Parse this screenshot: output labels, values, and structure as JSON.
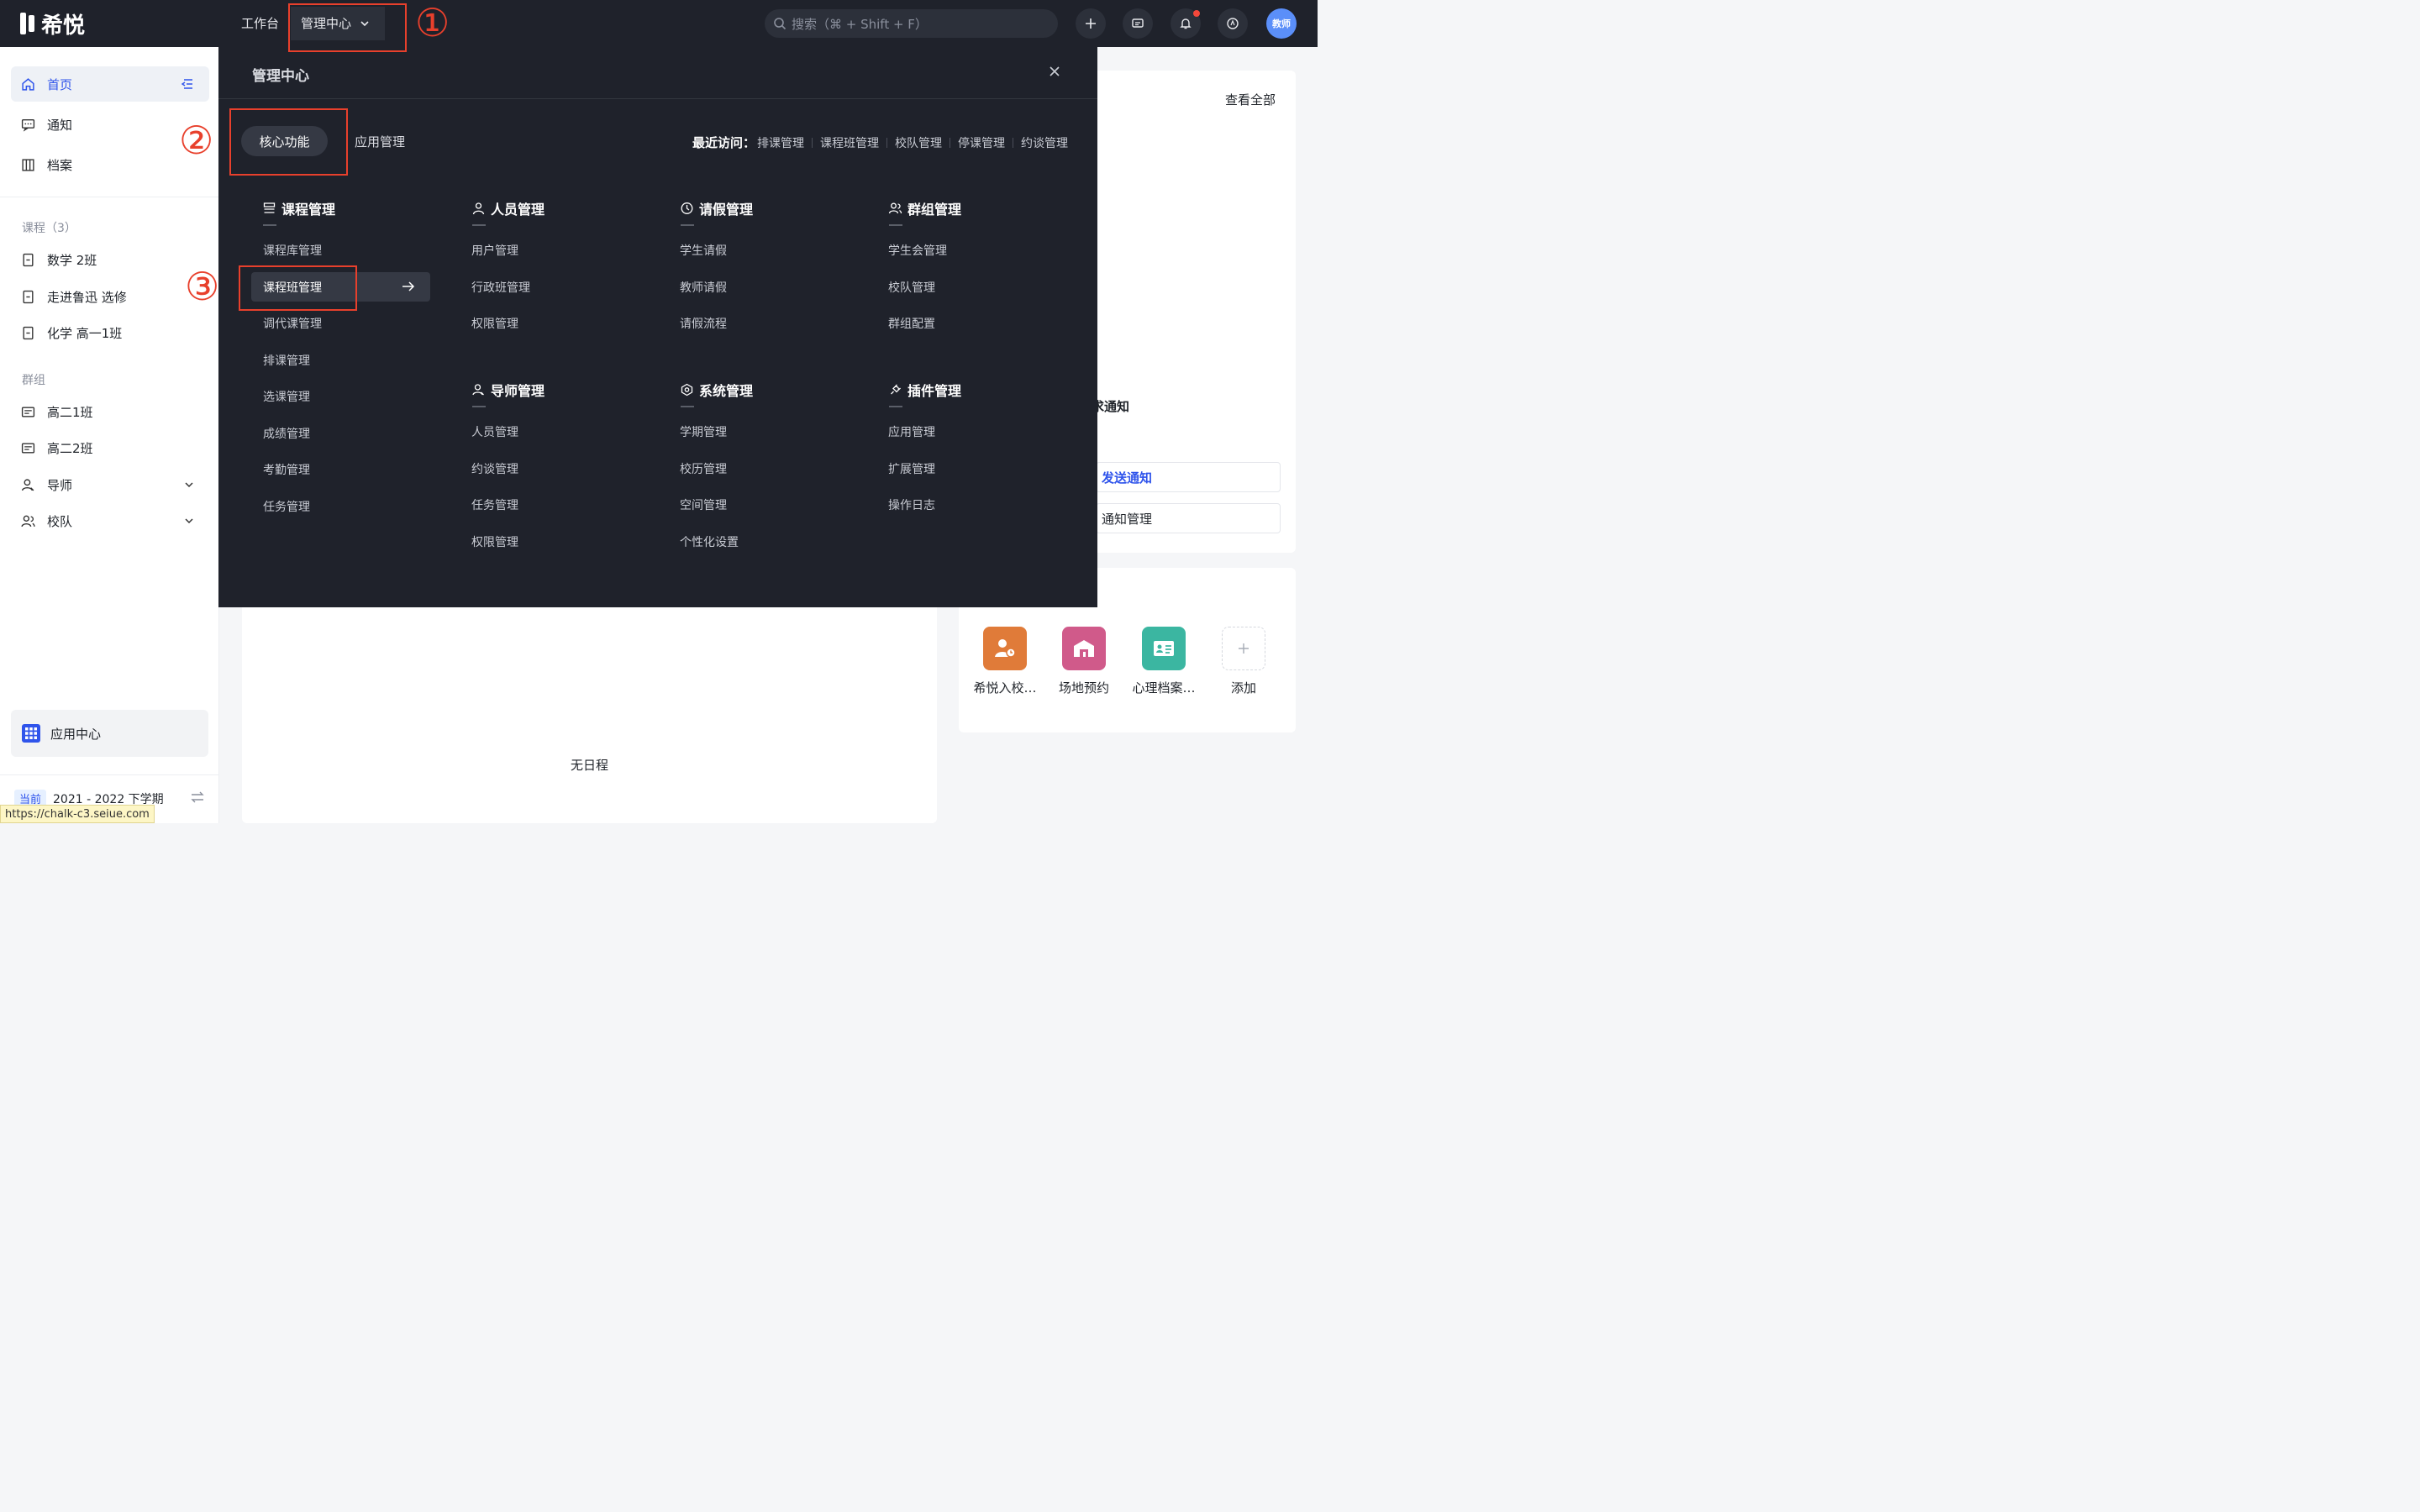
{
  "app": {
    "logo_text": "希悦"
  },
  "topbar": {
    "workbench": "工作台",
    "admin_center": "管理中心",
    "search_placeholder": "搜索（⌘ + Shift + F）",
    "avatar_text": "教师"
  },
  "sidebar": {
    "home": "首页",
    "notice": "通知",
    "archive": "档案",
    "courses_label": "课程（3）",
    "courses": [
      "数学 2班",
      "走进鲁迅 选修",
      "化学 高一1班"
    ],
    "groups_label": "群组",
    "groups": [
      "高二1班",
      "高二2班"
    ],
    "mentor": "导师",
    "team": "校队",
    "app_center": "应用中心",
    "term_badge": "当前",
    "term_name": "2021 - 2022 下学期"
  },
  "status_url": "https://chalk-c3.seiue.com",
  "main": {
    "view_all": "查看全部",
    "notice_partial": "求通知",
    "send_notice": "发送通知",
    "notice_manage": "通知管理",
    "no_schedule": "无日程",
    "apps": [
      "希悦入校…",
      "场地预约",
      "心理档案…",
      "添加"
    ]
  },
  "admin_menu": {
    "title": "管理中心",
    "tab_core": "核心功能",
    "tab_apps": "应用管理",
    "recent_label": "最近访问：",
    "recent_items": [
      "排课管理",
      "课程班管理",
      "校队管理",
      "停课管理",
      "约谈管理"
    ],
    "groups": [
      {
        "title": "课程管理",
        "items": [
          "课程库管理",
          "课程班管理",
          "调代课管理",
          "排课管理",
          "选课管理",
          "成绩管理",
          "考勤管理",
          "任务管理"
        ]
      },
      {
        "title": "人员管理",
        "items": [
          "用户管理",
          "行政班管理",
          "权限管理"
        ]
      },
      {
        "title": "请假管理",
        "items": [
          "学生请假",
          "教师请假",
          "请假流程"
        ]
      },
      {
        "title": "群组管理",
        "items": [
          "学生会管理",
          "校队管理",
          "群组配置"
        ]
      },
      {
        "title": "导师管理",
        "items": [
          "人员管理",
          "约谈管理",
          "任务管理",
          "权限管理"
        ]
      },
      {
        "title": "系统管理",
        "items": [
          "学期管理",
          "校历管理",
          "空间管理",
          "个性化设置"
        ]
      },
      {
        "title": "插件管理",
        "items": [
          "应用管理",
          "扩展管理",
          "操作日志"
        ]
      }
    ]
  },
  "annotations": [
    "①",
    "②",
    "③"
  ],
  "colors": {
    "accent": "#2f54eb",
    "annotation": "#e8402c",
    "menu_bg": "#1f222b"
  }
}
